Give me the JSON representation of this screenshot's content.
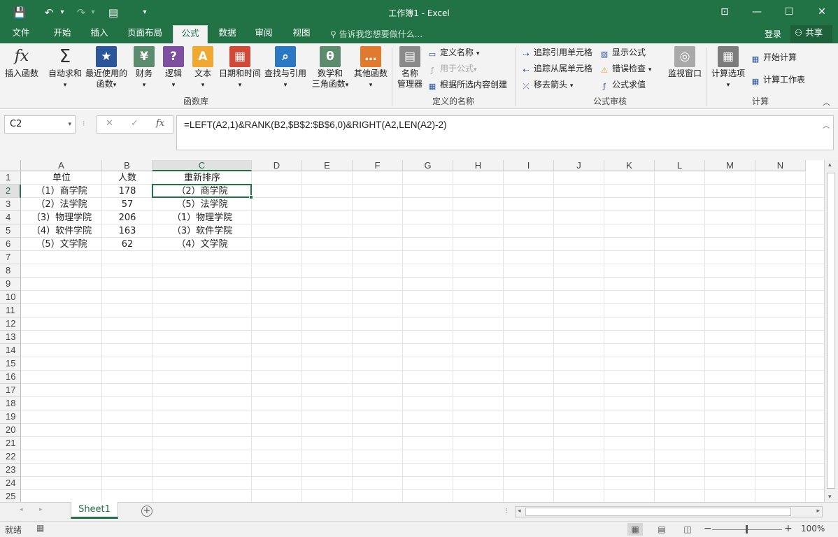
{
  "window": {
    "title": "工作簿1 - Excel"
  },
  "qat": {
    "save": "💾",
    "undo": "↶",
    "undo_drop": "▾",
    "redo": "↷",
    "redo_drop": "▾",
    "form": "▤",
    "custom": "▾"
  },
  "window_controls": {
    "restore_ribbon": "⊡",
    "minimize": "—",
    "maximize": "☐",
    "close": "✕"
  },
  "tabs": [
    "文件",
    "开始",
    "插入",
    "页面布局",
    "公式",
    "数据",
    "审阅",
    "视图"
  ],
  "tell_me": "告诉我您想要做什么...",
  "account": {
    "login": "登录",
    "share": "共享"
  },
  "ribbon": {
    "insert_function": "插入函数",
    "autosum": "自动求和",
    "recent": "最近使用的",
    "recent2": "函数",
    "financial": "财务",
    "logical": "逻辑",
    "text": "文本",
    "datetime": "日期和时间",
    "lookup": "查找与引用",
    "math1": "数学和",
    "math2": "三角函数",
    "more": "其他函数",
    "group_library": "函数库",
    "name_manager1": "名称",
    "name_manager2": "管理器",
    "define_name": "定义名称",
    "use_in_formula": "用于公式",
    "create_from_selection": "根据所选内容创建",
    "group_names": "定义的名称",
    "trace_precedents": "追踪引用单元格",
    "trace_dependents": "追踪从属单元格",
    "remove_arrows": "移去箭头",
    "show_formulas": "显示公式",
    "error_checking": "错误检查",
    "evaluate_formula": "公式求值",
    "group_auditing": "公式审核",
    "watch_window": "监视窗口",
    "calc_options": "计算选项",
    "calc_now": "开始计算",
    "calc_sheet": "计算工作表",
    "group_calc": "计算",
    "fx_icon": "fx",
    "sigma_icon": "Σ"
  },
  "formula_bar": {
    "name_box": "C2",
    "formula": "=LEFT(A2,1)&RANK(B2,$B$2:$B$6,0)&RIGHT(A2,LEN(A2)-2)",
    "cancel": "✕",
    "enter": "✓",
    "fx": "fx"
  },
  "columns": [
    "A",
    "B",
    "C",
    "D",
    "E",
    "F",
    "G",
    "H",
    "I",
    "J",
    "K",
    "L",
    "M",
    "N"
  ],
  "rows": [
    "1",
    "2",
    "3",
    "4",
    "5",
    "6",
    "7",
    "8",
    "9",
    "10",
    "11",
    "12",
    "13",
    "14",
    "15",
    "16",
    "17",
    "18",
    "19",
    "20",
    "21",
    "22",
    "23",
    "24",
    "25"
  ],
  "cells": {
    "A1": "单位",
    "B1": "人数",
    "C1": "重新排序",
    "A2": "（1）商学院",
    "B2": "178",
    "C2": "（2）商学院",
    "A3": "（2）法学院",
    "B3": "57",
    "C3": "（5）法学院",
    "A4": "（3）物理学院",
    "B4": "206",
    "C4": "（1）物理学院",
    "A5": "（4）软件学院",
    "B5": "163",
    "C5": "（3）软件学院",
    "A6": "（5）文学院",
    "B6": "62",
    "C6": "（4）文学院"
  },
  "sheet": {
    "name": "Sheet1",
    "add": "+"
  },
  "status": {
    "mode": "就绪",
    "zoom": "100%",
    "zoom_minus": "−",
    "zoom_plus": "+"
  }
}
